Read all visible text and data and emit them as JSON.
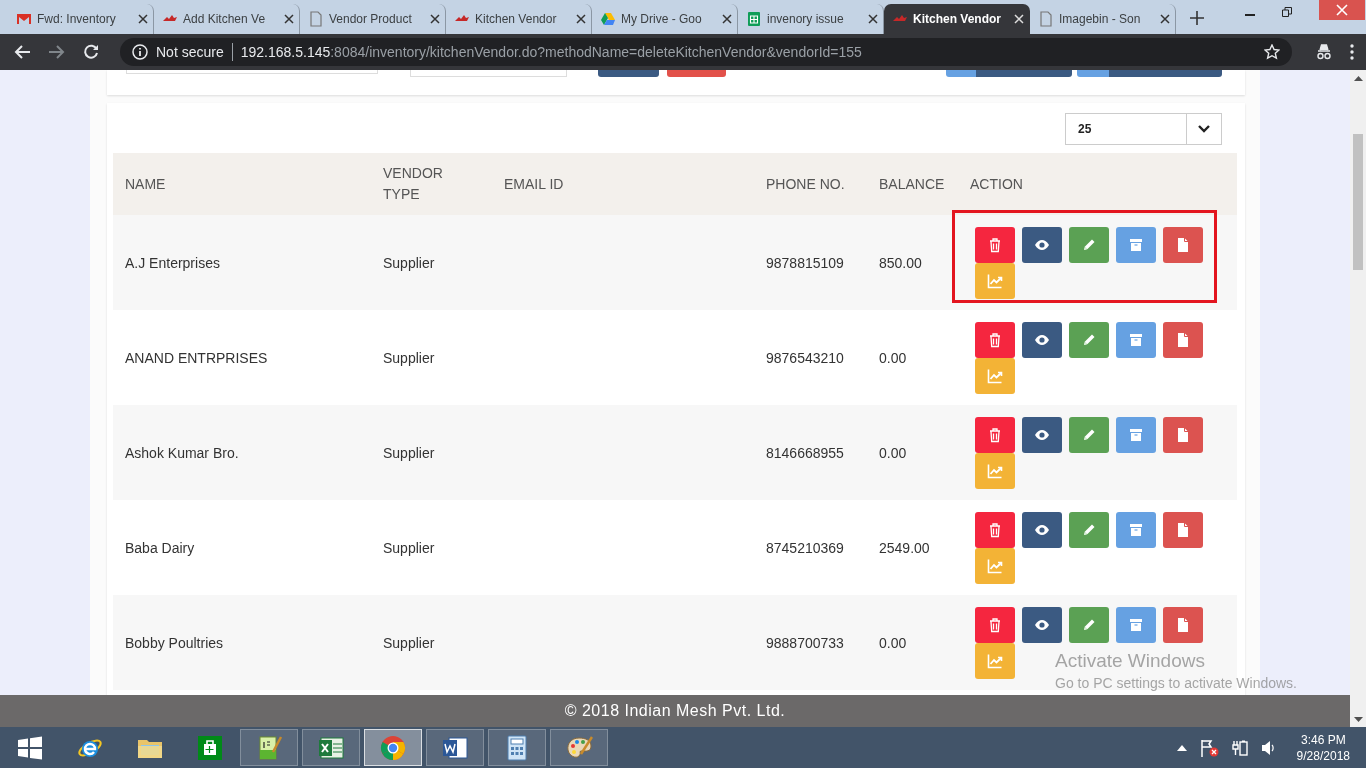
{
  "browser": {
    "tabs": [
      {
        "title": "Fwd: Inventory",
        "kind": "mail",
        "selected": false
      },
      {
        "title": "Add Kitchen Ve",
        "kind": "bird",
        "selected": false
      },
      {
        "title": "Vendor Product",
        "kind": "page",
        "selected": false
      },
      {
        "title": "Kitchen Vendor",
        "kind": "bird",
        "selected": false
      },
      {
        "title": "My Drive - Goo",
        "kind": "drive",
        "selected": false
      },
      {
        "title": "invenory issue",
        "kind": "sheet",
        "selected": false
      },
      {
        "title": "Kitchen Vendor",
        "kind": "bird",
        "selected": true
      },
      {
        "title": "Imagebin - Son",
        "kind": "page",
        "selected": false
      }
    ],
    "security": "Not secure",
    "url_host": "192.168.5.145",
    "url_rest": ":8084/inventory/kitchenVendor.do?methodName=deleteKitchenVendor&vendorId=155"
  },
  "page_size": "25",
  "table": {
    "columns": [
      "NAME",
      "VENDOR TYPE",
      "EMAIL ID",
      "PHONE NO.",
      "BALANCE",
      "ACTION"
    ],
    "row_actions": [
      {
        "kind": "delete"
      },
      {
        "kind": "view"
      },
      {
        "kind": "edit"
      },
      {
        "kind": "archive"
      },
      {
        "kind": "document"
      },
      {
        "kind": "chart"
      }
    ],
    "rows": [
      {
        "name": "A.J Enterprises",
        "vendor_type": "Supplier",
        "phone": "9878815109",
        "balance": "850.00",
        "highlighted": true
      },
      {
        "name": "ANAND ENTRPRISES",
        "vendor_type": "Supplier",
        "phone": "9876543210",
        "balance": "0.00",
        "highlighted": false
      },
      {
        "name": "Ashok Kumar Bro.",
        "vendor_type": "Supplier",
        "phone": "8146668955",
        "balance": "0.00",
        "highlighted": false
      },
      {
        "name": "Baba Dairy",
        "vendor_type": "Supplier",
        "phone": "8745210369",
        "balance": "2549.00",
        "highlighted": false
      },
      {
        "name": "Bobby Poultries",
        "vendor_type": "Supplier",
        "phone": "9888700733",
        "balance": "0.00",
        "highlighted": false
      }
    ]
  },
  "footer": "© 2018 Indian Mesh Pvt. Ltd.",
  "activation": {
    "title": "Activate Windows",
    "subtitle": "Go to PC settings to activate Windows."
  },
  "taskbar": {
    "apps": [
      {
        "kind": "start",
        "selected": false
      },
      {
        "kind": "ie",
        "selected": false
      },
      {
        "kind": "folder",
        "selected": false
      },
      {
        "kind": "store",
        "selected": false
      },
      {
        "kind": "notepad",
        "selected": false
      },
      {
        "kind": "excel",
        "selected": false
      },
      {
        "kind": "chrome",
        "selected": true
      },
      {
        "kind": "word",
        "selected": false
      },
      {
        "kind": "calc",
        "selected": false
      },
      {
        "kind": "paint",
        "selected": false
      }
    ],
    "time": "3:46 PM",
    "date": "9/28/2018"
  }
}
